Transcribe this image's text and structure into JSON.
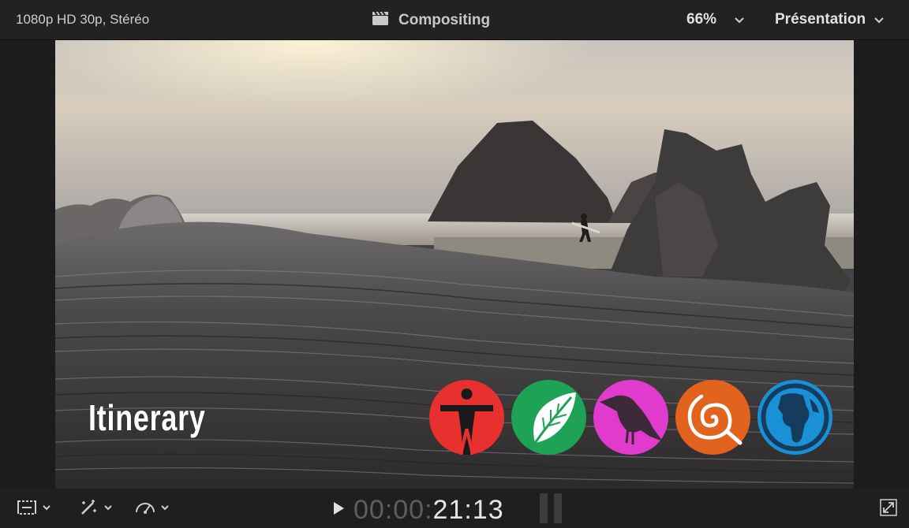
{
  "header": {
    "format_label": "1080p HD 30p, Stéréo",
    "viewer_title": "Compositing",
    "zoom_level": "66%",
    "view_menu_label": "Présentation"
  },
  "viewer": {
    "title_overlay": "Itinerary",
    "icons": [
      {
        "name": "vitruvian-figure-icon",
        "color": "#e8302e"
      },
      {
        "name": "leaf-icon",
        "color": "#1ea255"
      },
      {
        "name": "bird-icon",
        "color": "#e03bcc"
      },
      {
        "name": "spiral-icon",
        "color": "#e2631e"
      },
      {
        "name": "globe-figure-icon",
        "color": "#1a91d6"
      }
    ]
  },
  "footer": {
    "timecode_dim": "00:00:",
    "timecode_lit": "21:13"
  },
  "colors": {
    "background": "#1c1c1e",
    "bar": "#222224"
  }
}
